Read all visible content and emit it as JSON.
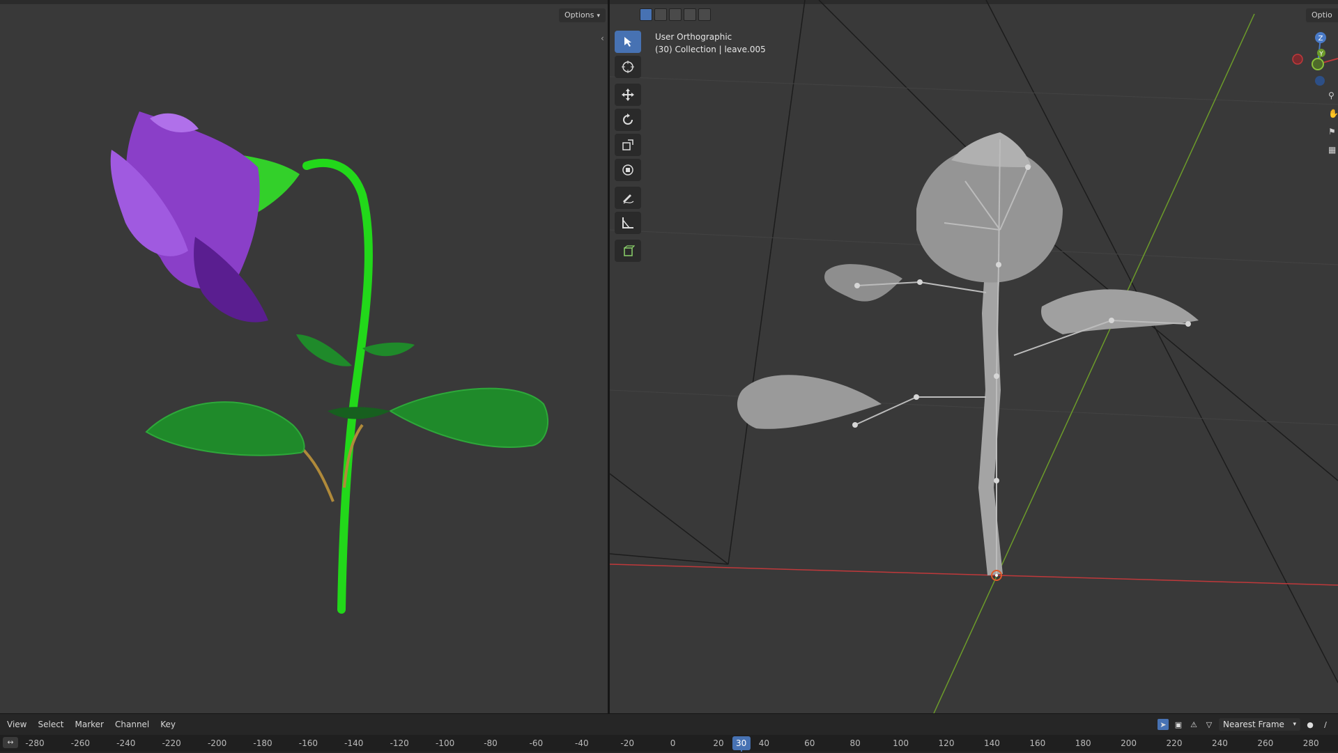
{
  "left_viewport": {
    "options_label": "Options"
  },
  "right_viewport": {
    "options_label": "Optio",
    "view_name": "User Orthographic",
    "view_context": "(30) Collection | leave.005",
    "gizmo_axes": {
      "z": "Z",
      "y": "Y"
    }
  },
  "tools": [
    {
      "name": "select-box-icon",
      "active": true
    },
    {
      "name": "cursor-icon",
      "active": false
    },
    {
      "name": "move-icon",
      "active": false
    },
    {
      "name": "rotate-icon",
      "active": false
    },
    {
      "name": "scale-icon",
      "active": false
    },
    {
      "name": "transform-icon",
      "active": false
    },
    {
      "name": "annotate-icon",
      "active": false
    },
    {
      "name": "measure-icon",
      "active": false
    },
    {
      "name": "add-cube-icon",
      "active": false
    }
  ],
  "timeline": {
    "menu": [
      "View",
      "Select",
      "Marker",
      "Channel",
      "Key"
    ],
    "snap_mode": "Nearest Frame",
    "current_frame": "30",
    "ticks": [
      "-280",
      "-260",
      "-240",
      "-220",
      "-200",
      "-180",
      "-160",
      "-140",
      "-120",
      "-100",
      "-80",
      "-60",
      "-40",
      "-20",
      "0",
      "20",
      "40",
      "60",
      "80",
      "100",
      "120",
      "140",
      "160",
      "180",
      "200",
      "220",
      "240",
      "260",
      "280"
    ]
  },
  "colors": {
    "accent": "#4772b3",
    "viewport_bg": "#393939",
    "axis_x": "#c0393b",
    "axis_y": "#6c9b2a",
    "petal": "#8a3fc8",
    "stem": "#22d81a",
    "leaf": "#1f8a2a",
    "mesh_gray": "#a4a4a4"
  }
}
